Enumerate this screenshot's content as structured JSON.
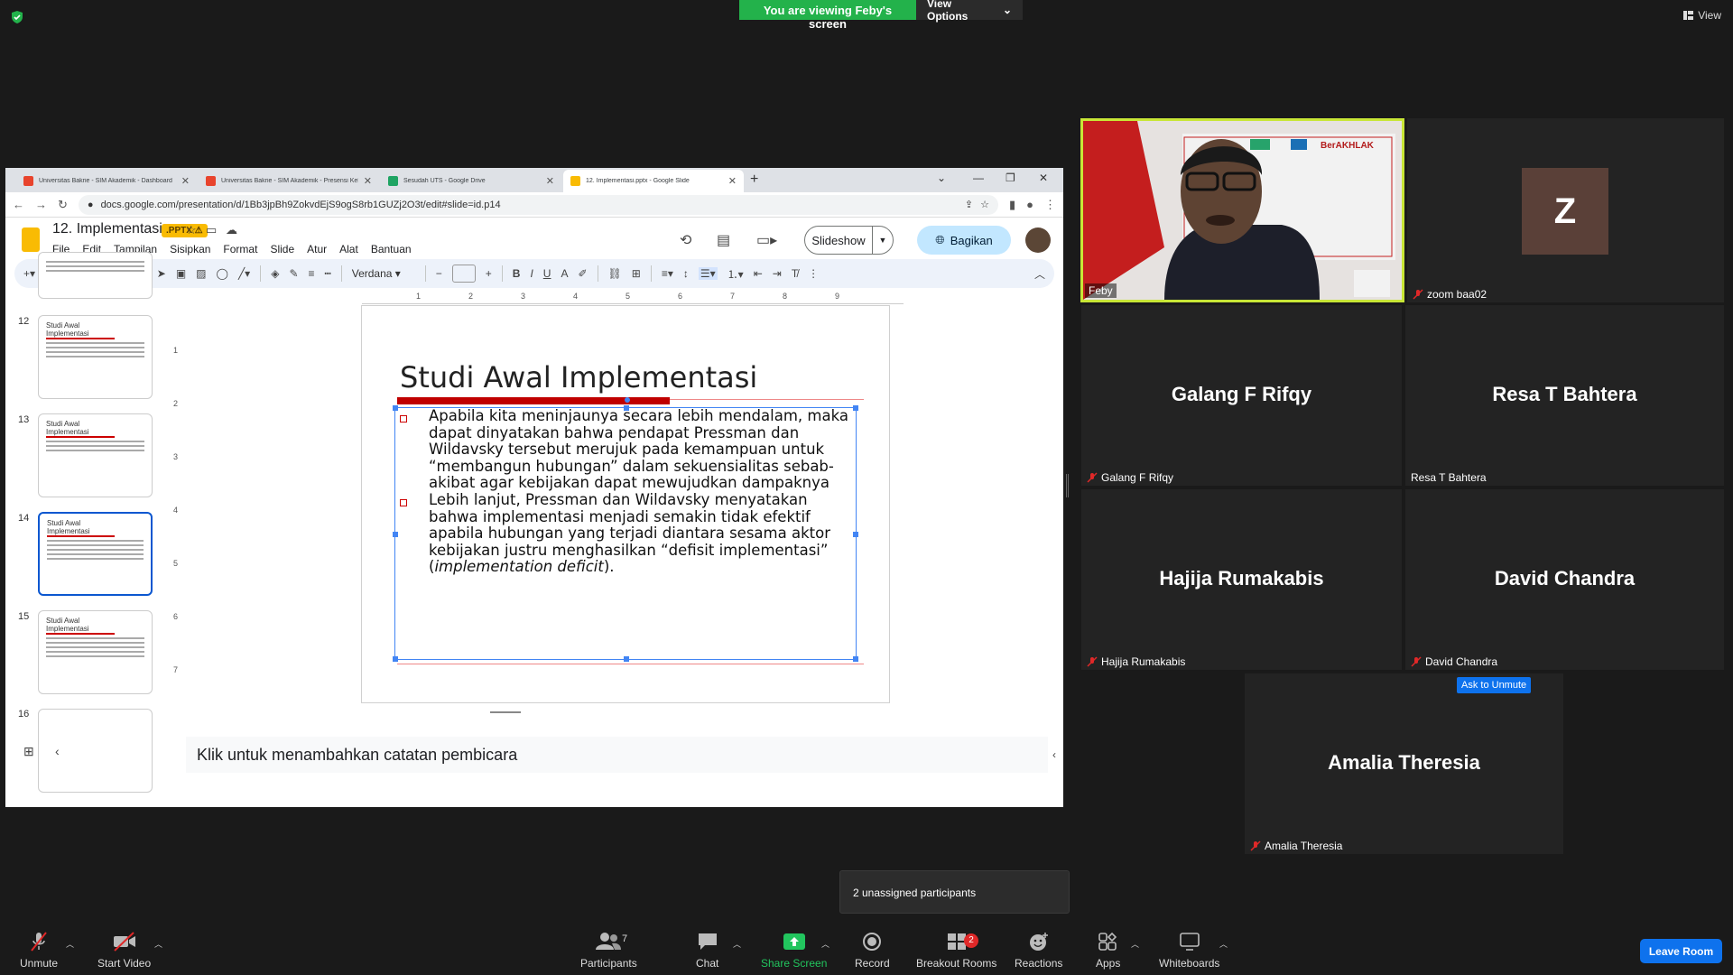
{
  "banner": {
    "viewing_text": "You are viewing Feby's screen",
    "view_options": "View Options"
  },
  "view_button": "View",
  "browser": {
    "tabs": [
      {
        "title": "Universitas Bakrie - SIM Akademik - Dashboard",
        "color": "#e8442d"
      },
      {
        "title": "Universitas Bakrie - SIM Akademik - Presensi Kelas",
        "color": "#e8442d"
      },
      {
        "title": "Sesudah UTS - Google Drive",
        "color": "#1fa463"
      },
      {
        "title": "12. Implementasi.pptx - Google Slide",
        "color": "#f9bb03"
      }
    ],
    "url": "docs.google.com/presentation/d/1Bb3jpBh9ZokvdEjS9ogS8rb1GUZj2O3t/edit#slide=id.p14"
  },
  "slides_app": {
    "doc_title": "12. Implementasi",
    "badge": ".PPTX",
    "menus": [
      "File",
      "Edit",
      "Tampilan",
      "Sisipkan",
      "Format",
      "Slide",
      "Atur",
      "Alat",
      "Bantuan"
    ],
    "slideshow_label": "Slideshow",
    "share_label": "Bagikan",
    "font_name": "Verdana",
    "ruler_top": [
      "1",
      "2",
      "3",
      "4",
      "5",
      "6",
      "7",
      "8",
      "9"
    ],
    "ruler_left": [
      "1",
      "2",
      "3",
      "4",
      "5",
      "6",
      "7"
    ],
    "thumbnails": [
      {
        "num": "12",
        "title": "Studi Awal Implementasi"
      },
      {
        "num": "13",
        "title": "Studi Awal Implementasi"
      },
      {
        "num": "14",
        "title": "Studi Awal Implementasi"
      },
      {
        "num": "15",
        "title": "Studi Awal Implementasi"
      },
      {
        "num": "16",
        "title": ""
      }
    ],
    "slide": {
      "title": "Studi Awal Implementasi",
      "para1": "Apabila kita meninjaunya secara lebih mendalam, maka dapat dinyatakan bahwa pendapat Pressman dan Wildavsky tersebut merujuk pada kemampuan untuk “membangun hubungan” dalam sekuensialitas sebab-akibat agar kebijakan dapat mewujudkan dampaknya",
      "para2_prefix": "Lebih lanjut, Pressman dan Wildavsky menyatakan bahwa implementasi menjadi semakin tidak efektif apabila hubungan yang terjadi diantara sesama aktor kebijakan justru menghasilkan “defisit implementasi” (",
      "para2_italic": "implementation deficit",
      "para2_suffix": ")."
    },
    "notes_placeholder": "Klik untuk menambahkan catatan pembicara"
  },
  "participants": [
    {
      "name": "Feby"
    },
    {
      "name": "zoom baa02",
      "initial": "Z"
    },
    {
      "name": "Galang F Rifqy"
    },
    {
      "name": "Resa T Bahtera"
    },
    {
      "name": "Hajija Rumakabis"
    },
    {
      "name": "David Chandra"
    },
    {
      "name": "Amalia Theresia"
    }
  ],
  "ask_to_unmute": "Ask to Unmute",
  "unassigned": "2 unassigned participants",
  "toolbar": {
    "unmute": "Unmute",
    "start_video": "Start Video",
    "participants": "Participants",
    "participants_count": "7",
    "chat": "Chat",
    "share_screen": "Share Screen",
    "record": "Record",
    "breakout_rooms": "Breakout Rooms",
    "breakout_badge": "2",
    "reactions": "Reactions",
    "apps": "Apps",
    "whiteboards": "Whiteboards",
    "leave_room": "Leave Room"
  }
}
